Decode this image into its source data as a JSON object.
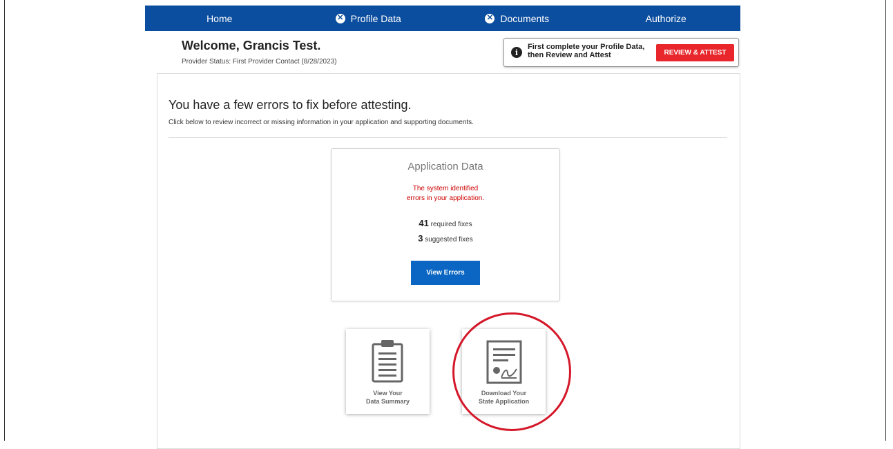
{
  "nav": {
    "items": [
      {
        "label": "Home",
        "icon": null
      },
      {
        "label": "Profile Data",
        "icon": "error-x-icon"
      },
      {
        "label": "Documents",
        "icon": "error-x-icon"
      },
      {
        "label": "Authorize",
        "icon": null
      }
    ],
    "color": "#0b4d9e"
  },
  "header": {
    "welcome": "Welcome, Grancis Test.",
    "status": "Provider Status: First Provider Contact (8/28/2023)"
  },
  "attest_notice": {
    "icon": "info-icon",
    "line1": "First complete your Profile Data,",
    "line2": "then Review and Attest",
    "button_label": "REVIEW & ATTEST",
    "button_color": "#e8262b"
  },
  "main": {
    "heading": "You have a few errors to fix before attesting.",
    "subtext": "Click below to review incorrect or missing information in your application and supporting documents."
  },
  "application_card": {
    "title": "Application Data",
    "error_line1": "The system identified",
    "error_line2": "errors in your application.",
    "required_count": "41",
    "required_label": "required fixes",
    "suggested_count": "3",
    "suggested_label": "suggested fixes",
    "button_label": "View Errors",
    "error_color": "#cc0000"
  },
  "tiles": [
    {
      "icon": "clipboard-icon",
      "line1": "View Your",
      "line2": "Data Summary"
    },
    {
      "icon": "certificate-document-icon",
      "line1": "Download Your",
      "line2": "State Application"
    }
  ],
  "annotation": {
    "color": "#d4182a"
  }
}
